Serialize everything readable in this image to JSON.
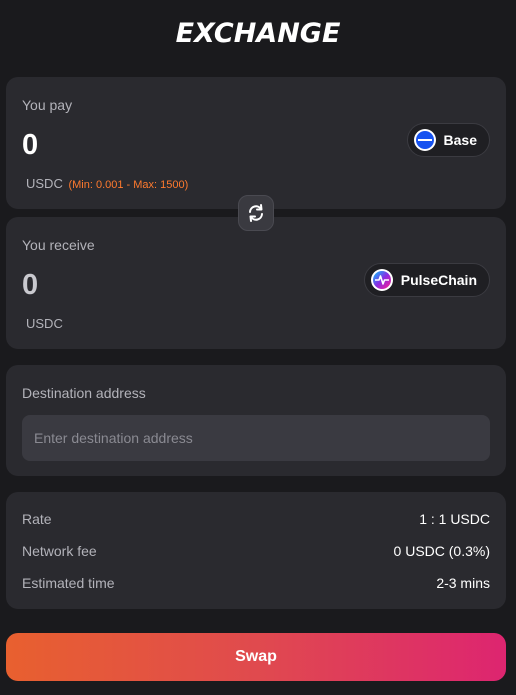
{
  "header": {
    "title": "EXCHANGE"
  },
  "pay": {
    "label": "You pay",
    "amount": "0",
    "token": "USDC",
    "limits": "(Min: 0.001 - Max: 1500)",
    "chain": {
      "name": "Base",
      "icon": "base-chain-icon"
    }
  },
  "switch": {
    "icon": "swap-arrows-icon"
  },
  "receive": {
    "label": "You receive",
    "amount": "0",
    "token": "USDC",
    "chain": {
      "name": "PulseChain",
      "icon": "pulsechain-icon"
    }
  },
  "destination": {
    "label": "Destination address",
    "placeholder": "Enter destination address",
    "value": ""
  },
  "details": {
    "rows": [
      {
        "label": "Rate",
        "value": "1 : 1 USDC"
      },
      {
        "label": "Network fee",
        "value": "0 USDC (0.3%)"
      },
      {
        "label": "Estimated time",
        "value": "2-3 mins"
      }
    ]
  },
  "actions": {
    "swap_label": "Swap"
  },
  "colors": {
    "background": "#1a1a1d",
    "card": "#2a2a2f",
    "accent_orange": "#ff7a2e",
    "gradient_start": "#e8602f",
    "gradient_end": "#dd2570",
    "base_blue": "#1652f0"
  }
}
